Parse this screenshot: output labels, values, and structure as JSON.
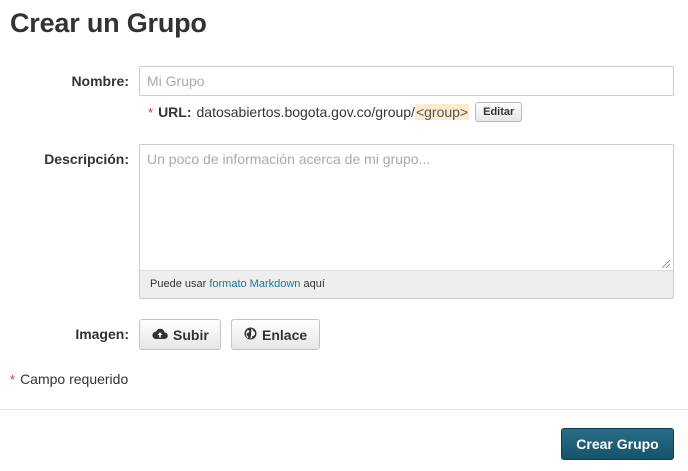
{
  "page": {
    "title": "Crear un Grupo"
  },
  "form": {
    "name": {
      "label": "Nombre:",
      "placeholder": "Mi Grupo",
      "value": ""
    },
    "url": {
      "required_mark": "*",
      "label": "URL:",
      "prefix": "datosabiertos.bogota.gov.co/group/",
      "slug": "<group>",
      "edit_label": "Editar"
    },
    "description": {
      "label": "Descripción:",
      "placeholder": "Un poco de información acerca de mi grupo...",
      "value": "",
      "help_prefix": "Puede usar",
      "help_link": "formato Markdown",
      "help_suffix": "aquí"
    },
    "image": {
      "label": "Imagen:",
      "upload_label": "Subir",
      "upload_icon": "cloud-upload-icon",
      "link_label": "Enlace",
      "link_icon": "globe-icon"
    },
    "required_note": {
      "mark": "*",
      "text": "Campo requerido"
    },
    "submit_label": "Crear Grupo"
  },
  "colors": {
    "primary_button": "#1b5f78",
    "required_mark": "#c6373f",
    "link": "#187794",
    "slug_highlight": "#faebcc"
  }
}
